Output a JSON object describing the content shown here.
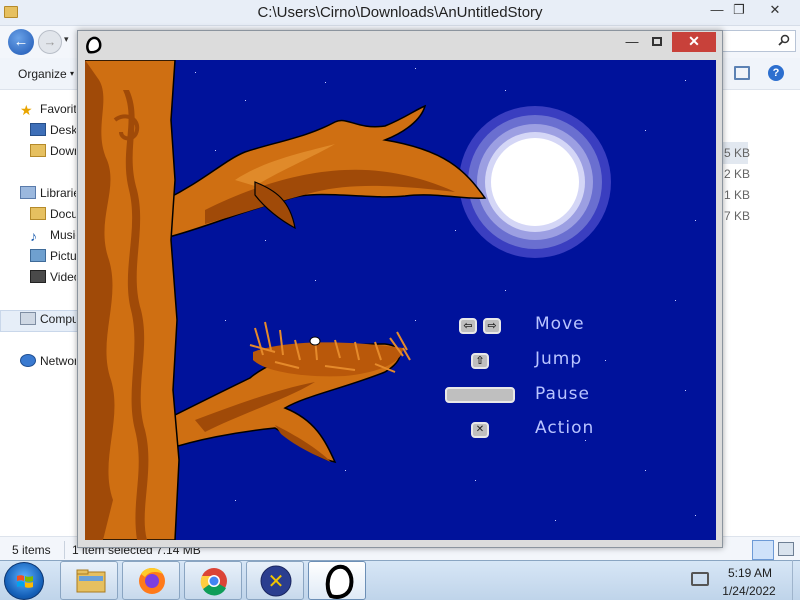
{
  "explorer": {
    "title": "C:\\Users\\Cirno\\Downloads\\AnUntitledStory",
    "controls": {
      "minimize": "—",
      "maximize": "❐",
      "close": "✕"
    },
    "search_icon": "search-icon",
    "back_glyph": "←",
    "forward_glyph": "→",
    "dropdown_glyph": "▾",
    "toolbar": {
      "organize": "Organize",
      "organize_chevron": "▾",
      "help": "?"
    },
    "nav": [
      {
        "label": "Favorites",
        "icon": "star-icon",
        "glyph": "★"
      },
      {
        "label": "Desktop",
        "icon": "desktop-icon"
      },
      {
        "label": "Downloads",
        "icon": "folder-icon"
      },
      {
        "label": "Libraries",
        "icon": "library-icon"
      },
      {
        "label": "Documents",
        "icon": "document-icon"
      },
      {
        "label": "Music",
        "icon": "music-icon",
        "glyph": "♪"
      },
      {
        "label": "Pictures",
        "icon": "pictures-icon"
      },
      {
        "label": "Videos",
        "icon": "videos-icon"
      },
      {
        "label": "Computer",
        "icon": "computer-icon"
      },
      {
        "label": "Network",
        "icon": "network-icon"
      }
    ],
    "file_sizes": [
      "5 KB",
      "2 KB",
      "1 KB",
      "7 KB"
    ],
    "status": {
      "items": "5 items",
      "selected": "1 item selected  7.14 MB"
    }
  },
  "game": {
    "window_controls": {
      "minimize": "—",
      "close": "✕"
    },
    "colors": {
      "sky": "#00129b",
      "bark": "#cf6f12",
      "bark_dark": "#a04a08",
      "moon": "#ffffff",
      "halo": "#8c8fd6",
      "label": "#b9c4ff"
    },
    "controls": [
      {
        "keys": [
          "⇦",
          "⇨"
        ],
        "label": "Move"
      },
      {
        "keys": [
          "⇧"
        ],
        "label": "Jump"
      },
      {
        "keys": [
          "space-bar"
        ],
        "label": "Pause"
      },
      {
        "keys": [
          "✕"
        ],
        "label": "Action"
      }
    ]
  },
  "taskbar": {
    "apps": [
      {
        "name": "file-explorer",
        "icon": "folder-icon"
      },
      {
        "name": "firefox",
        "icon": "firefox-icon"
      },
      {
        "name": "chrome",
        "icon": "chrome-icon"
      },
      {
        "name": "app-x",
        "icon": "x-app-icon",
        "glyph": "✕"
      },
      {
        "name": "an-untitled-story",
        "icon": "blob-icon"
      }
    ],
    "time": "5:19 AM",
    "date": "1/24/2022"
  }
}
